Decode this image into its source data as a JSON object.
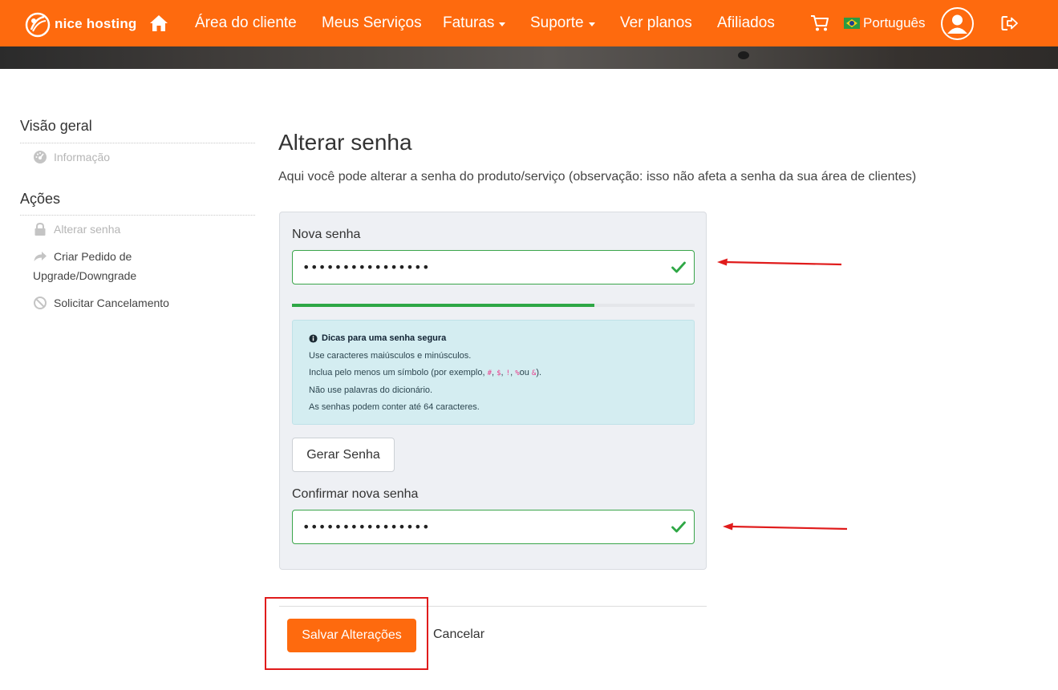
{
  "brand": {
    "name": "nice hosting",
    "color": "#fe6a0e"
  },
  "nav": {
    "items": [
      {
        "label": "Área do cliente"
      },
      {
        "label": "Meus Serviços"
      },
      {
        "label": "Faturas"
      },
      {
        "label": "Suporte"
      },
      {
        "label": "Ver planos"
      },
      {
        "label": "Afiliados"
      }
    ],
    "language": "Português",
    "icons": [
      "home-icon",
      "cart-icon",
      "brazil-flag-icon",
      "user-avatar-icon",
      "logout-icon"
    ]
  },
  "sidebar": {
    "overview_heading": "Visão geral",
    "overview_items": [
      {
        "label": "Informação",
        "icon": "dashboard-icon"
      }
    ],
    "actions_heading": "Ações",
    "action_items": [
      {
        "label": "Alterar senha",
        "icon": "lock-icon"
      },
      {
        "label": "Criar Pedido de Upgrade/Downgrade",
        "icon": "share-arrow-icon"
      },
      {
        "label": "Solicitar Cancelamento",
        "icon": "ban-icon"
      }
    ]
  },
  "main": {
    "title": "Alterar senha",
    "description": "Aqui você pode alterar a senha do produto/serviço (observação: isso não afeta a senha da sua área de clientes)",
    "new_password": {
      "label": "Nova senha",
      "value": "••••••••••••••••"
    },
    "strength": {
      "fraction": 0.75,
      "color": "#2ea745"
    },
    "tips": {
      "title": "Dicas para uma senha segura",
      "line1": "Use caracteres maiúsculos e minúsculos.",
      "line2_prefix": "Inclua pelo menos um símbolo (por exemplo, ",
      "symbols": [
        "#",
        "$",
        "!",
        "%",
        "&"
      ],
      "sep1": ", ",
      "sep2": ", ",
      "sep3": ", ",
      "or_word": "ou ",
      "line2_suffix": ").",
      "line3": "Não use palavras do dicionário.",
      "line4": "As senhas podem conter até 64 caracteres."
    },
    "generate_label": "Gerar Senha",
    "confirm_password": {
      "label": "Confirmar nova senha",
      "value": "••••••••••••••••"
    },
    "save_label": "Salvar Alterações",
    "cancel_label": "Cancelar"
  },
  "annotation_color": "#e01b1b"
}
